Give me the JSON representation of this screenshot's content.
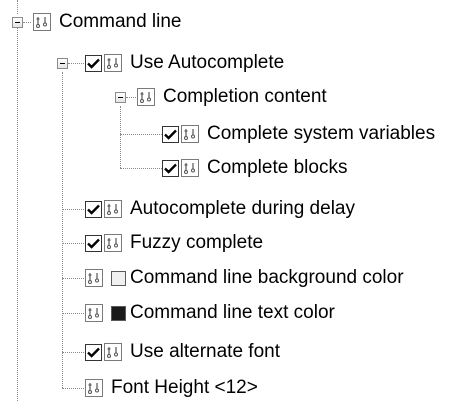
{
  "tree": {
    "items": [
      {
        "label": "Command line",
        "checked": null,
        "icon": "property-icon",
        "expanded": true
      },
      {
        "label": "Use Autocomplete",
        "checked": true,
        "icon": "property-icon",
        "expanded": true
      },
      {
        "label": "Completion content",
        "checked": null,
        "icon": "property-icon",
        "expanded": true
      },
      {
        "label": "Complete system variables",
        "checked": true,
        "icon": "property-icon"
      },
      {
        "label": "Complete blocks",
        "checked": true,
        "icon": "property-icon"
      },
      {
        "label": "Autocomplete during delay",
        "checked": true,
        "icon": "property-icon"
      },
      {
        "label": "Fuzzy complete",
        "checked": true,
        "icon": "property-icon"
      },
      {
        "label": "Command line background color",
        "checked": null,
        "icon": "property-icon",
        "swatch_color": "#f0f0f0"
      },
      {
        "label": "Command line text color",
        "checked": null,
        "icon": "property-icon",
        "swatch_color": "#1a1a1a"
      },
      {
        "label": "Use alternate font",
        "checked": true,
        "icon": "property-icon"
      },
      {
        "label": "Font Height <12>",
        "checked": null,
        "icon": "property-icon"
      }
    ]
  },
  "colors": {
    "tree_line": "#8a8a8a",
    "text": "#000000",
    "background": "#ffffff"
  }
}
